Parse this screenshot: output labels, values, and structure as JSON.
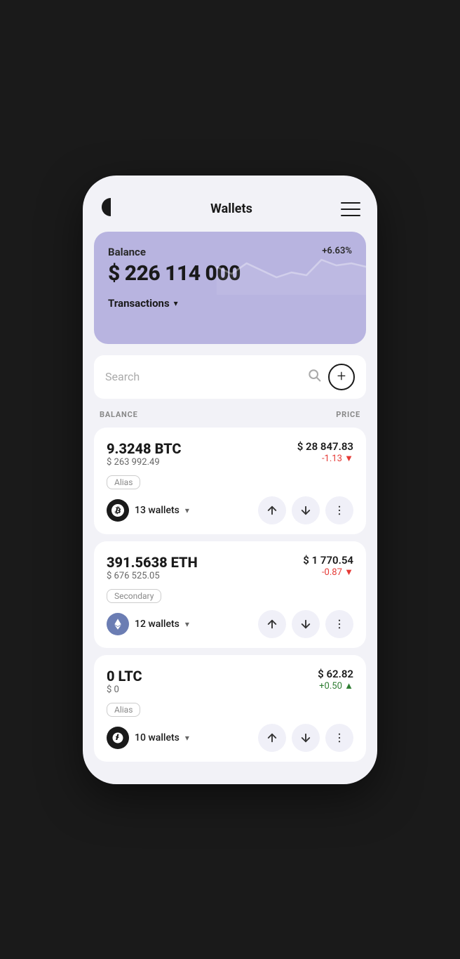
{
  "header": {
    "title": "Wallets",
    "logo": "logo-icon",
    "menu": "menu-icon"
  },
  "balance_card": {
    "label": "Balance",
    "amount": "$ 226 114 000",
    "percent": "+6.63%",
    "transactions_label": "Transactions"
  },
  "search": {
    "placeholder": "Search",
    "add_button": "+"
  },
  "columns": {
    "balance": "BALANCE",
    "price": "PRICE"
  },
  "cryptos": [
    {
      "amount": "9.3248 BTC",
      "usd_value": "$ 263 992.49",
      "price": "$ 28 847.83",
      "change": "-1.13",
      "change_direction": "negative",
      "alias": "Alias",
      "wallets": "13 wallets",
      "coin": "BTC"
    },
    {
      "amount": "391.5638 ETH",
      "usd_value": "$ 676 525.05",
      "price": "$ 1 770.54",
      "change": "-0.87",
      "change_direction": "negative",
      "alias": "Secondary",
      "wallets": "12 wallets",
      "coin": "ETH"
    },
    {
      "amount": "0 LTC",
      "usd_value": "$ 0",
      "price": "$ 62.82",
      "change": "+0.50",
      "change_direction": "positive",
      "alias": "Alias",
      "wallets": "10 wallets",
      "coin": "LTC"
    }
  ]
}
